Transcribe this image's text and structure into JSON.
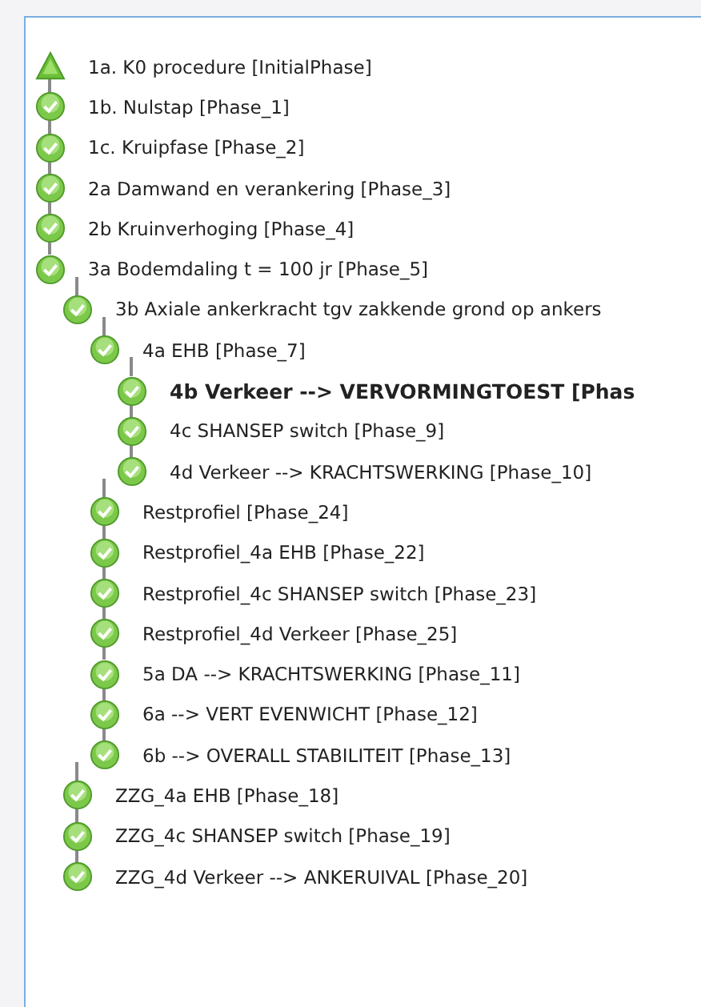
{
  "phases": [
    {
      "label": "1a. K0 procedure [InitialPhase]",
      "kind": "initial",
      "selected": false
    },
    {
      "label": "1b. Nulstap [Phase_1]",
      "kind": "phase",
      "selected": false
    },
    {
      "label": "1c. Kruipfase [Phase_2]",
      "kind": "phase",
      "selected": false
    },
    {
      "label": "2a Damwand en verankering [Phase_3]",
      "kind": "phase",
      "selected": false
    },
    {
      "label": "2b Kruinverhoging [Phase_4]",
      "kind": "phase",
      "selected": false
    },
    {
      "label": "3a Bodemdaling t = 100 jr [Phase_5]",
      "kind": "phase",
      "selected": false,
      "children": [
        {
          "label": "3b Axiale ankerkracht tgv zakkende grond op ankers",
          "kind": "phase",
          "selected": false,
          "children": [
            {
              "label": "4a EHB [Phase_7]",
              "kind": "phase",
              "selected": false,
              "children": [
                {
                  "label": "4b Verkeer --> VERVORMINGTOEST [Phas",
                  "kind": "phase",
                  "selected": true
                },
                {
                  "label": "4c SHANSEP switch [Phase_9]",
                  "kind": "phase",
                  "selected": false
                },
                {
                  "label": "4d Verkeer --> KRACHTSWERKING [Phase_10]",
                  "kind": "phase",
                  "selected": false
                }
              ]
            },
            {
              "label": "Restprofiel [Phase_24]",
              "kind": "phase",
              "selected": false
            },
            {
              "label": "Restprofiel_4a EHB [Phase_22]",
              "kind": "phase",
              "selected": false
            },
            {
              "label": "Restprofiel_4c SHANSEP switch [Phase_23]",
              "kind": "phase",
              "selected": false
            },
            {
              "label": "Restprofiel_4d Verkeer [Phase_25]",
              "kind": "phase",
              "selected": false
            },
            {
              "label": "5a DA --> KRACHTSWERKING [Phase_11]",
              "kind": "phase",
              "selected": false
            },
            {
              "label": "6a --> VERT EVENWICHT [Phase_12]",
              "kind": "phase",
              "selected": false
            },
            {
              "label": "6b --> OVERALL STABILITEIT [Phase_13]",
              "kind": "phase",
              "selected": false
            }
          ]
        },
        {
          "label": "ZZG_4a EHB [Phase_18]",
          "kind": "phase",
          "selected": false
        },
        {
          "label": "ZZG_4c SHANSEP switch [Phase_19]",
          "kind": "phase",
          "selected": false
        },
        {
          "label": "ZZG_4d Verkeer --> ANKERUIVAL [Phase_20]",
          "kind": "phase",
          "selected": false
        }
      ]
    }
  ]
}
